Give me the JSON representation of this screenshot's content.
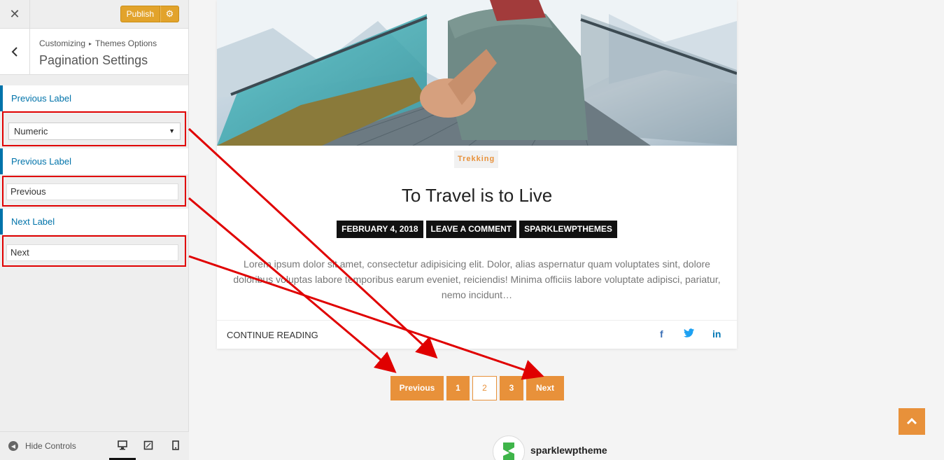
{
  "topbar": {
    "close_icon": "close-icon",
    "publish_label": "Publish",
    "gear_icon": "gear-icon"
  },
  "section": {
    "breadcrumb": [
      "Customizing",
      "Themes Options"
    ],
    "breadcrumb_separator": "▸",
    "title": "Pagination Settings",
    "back_icon": "chevron-left-icon"
  },
  "controls": [
    {
      "label": "Previous Label",
      "type": "select",
      "value": "Numeric"
    },
    {
      "label": "Previous Label",
      "type": "text",
      "value": "Previous"
    },
    {
      "label": "Next Label",
      "type": "text",
      "value": "Next"
    }
  ],
  "sidebar_footer": {
    "hide_controls_label": "Hide Controls",
    "devices": [
      "desktop-icon",
      "tablet-icon",
      "mobile-icon"
    ]
  },
  "post": {
    "category": "Trekking",
    "title": "To Travel is to Live",
    "meta": [
      "FEBRUARY 4, 2018",
      "LEAVE A COMMENT",
      "SPARKLEWPTHEMES"
    ],
    "excerpt": "Lorem ipsum dolor sit amet, consectetur adipisicing elit. Dolor, alias aspernatur quam voluptates sint, dolore doloribus voluptas labore temporibus earum eveniet, reiciendis! Minima officiis labore voluptate adipisci, pariatur, nemo incidunt…",
    "continue_label": "CONTINUE READING",
    "share": [
      "facebook-icon",
      "twitter-icon",
      "linkedin-icon"
    ]
  },
  "pagination": {
    "previous": "Previous",
    "pages": [
      "1",
      "2",
      "3"
    ],
    "current": "2",
    "next": "Next"
  },
  "footer": {
    "brand": "sparklewptheme"
  },
  "colors": {
    "accent": "#e8913a",
    "wp_blue": "#0073aa",
    "publish": "#e2a32b",
    "annotation": "#e00000"
  }
}
